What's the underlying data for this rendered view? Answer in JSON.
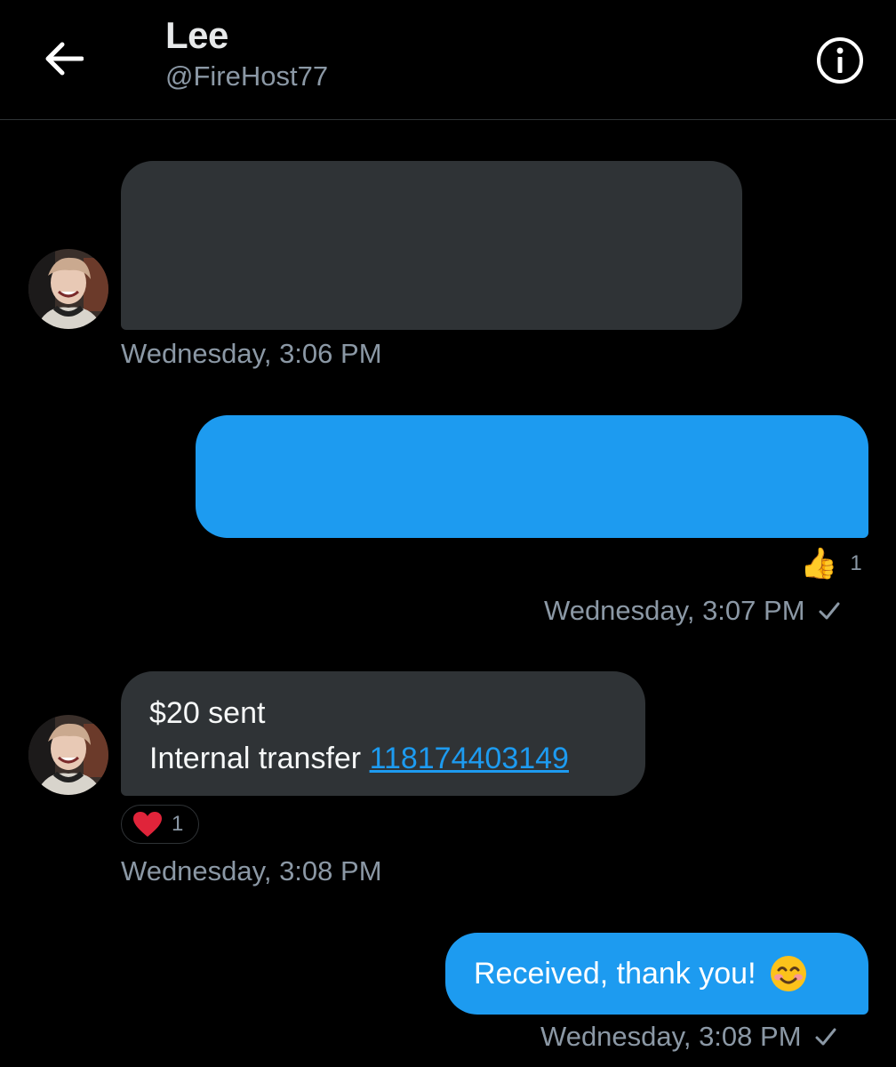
{
  "header": {
    "name": "Lee",
    "handle": "@FireHost77"
  },
  "icons": {
    "back": "arrow-left-icon",
    "info": "info-circle-icon",
    "thumbs_up": "thumbs-up-emoji",
    "heart": "heart-emoji",
    "smile": "smiling-face-emoji",
    "sent_check": "checkmark-icon"
  },
  "messages": [
    {
      "from": "contact",
      "redacted": true,
      "timestamp": "Wednesday, 3:06 PM"
    },
    {
      "from": "me",
      "redacted": true,
      "reaction": {
        "emoji": "👍",
        "count": "1"
      },
      "timestamp": "Wednesday, 3:07 PM"
    },
    {
      "from": "contact",
      "line1": "$20 sent",
      "line2_prefix": "Internal transfer ",
      "line2_link": "118174403149",
      "reaction": {
        "emoji": "❤️",
        "count": "1"
      },
      "timestamp": "Wednesday, 3:08 PM"
    },
    {
      "from": "me",
      "text": "Received, thank you!",
      "emoji": "😊",
      "timestamp": "Wednesday, 3:08 PM"
    }
  ],
  "colors": {
    "background": "#000000",
    "incoming_bubble": "#2f3336",
    "outgoing_bubble": "#1d9bf0",
    "muted_text": "#8b98a5",
    "link": "#1d9bf0"
  }
}
